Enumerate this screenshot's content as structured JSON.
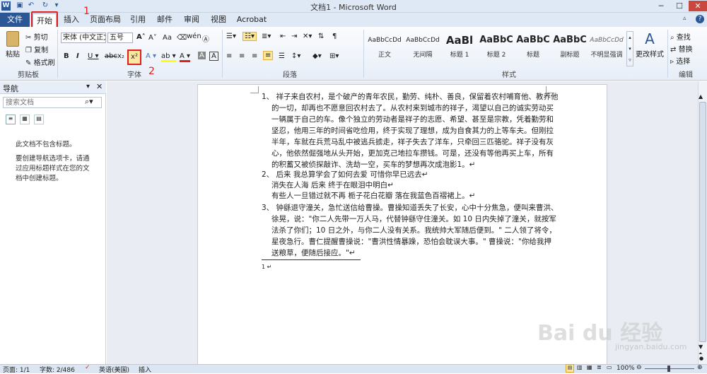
{
  "window": {
    "title": "文档1 - Microsoft Word"
  },
  "tabs": [
    "文件",
    "开始",
    "插入",
    "页面布局",
    "引用",
    "邮件",
    "审阅",
    "视图",
    "Acrobat"
  ],
  "annotations": {
    "mark1": "1",
    "mark2": "2"
  },
  "clipboard": {
    "paste": "粘贴",
    "cut": "剪切",
    "copy": "复制",
    "format_painter": "格式刷",
    "group": "剪贴板"
  },
  "font": {
    "name": "宋体 (中文正文)",
    "size": "五号",
    "group": "字体"
  },
  "paragraph": {
    "group": "段落"
  },
  "styles": {
    "group": "样式",
    "items": [
      {
        "preview": "AaBbCcDd",
        "label": "正文"
      },
      {
        "preview": "AaBbCcDd",
        "label": "无间隔"
      },
      {
        "preview": "AaBl",
        "label": "标题 1"
      },
      {
        "preview": "AaBbC",
        "label": "标题 2"
      },
      {
        "preview": "AaBbC",
        "label": "标题"
      },
      {
        "preview": "AaBbC",
        "label": "副标题"
      },
      {
        "preview": "AaBbCcDd",
        "label": "不明显强调"
      }
    ],
    "change": "更改样式"
  },
  "editing": {
    "find": "查找",
    "replace": "替换",
    "select": "选择",
    "group": "编辑"
  },
  "nav": {
    "title": "导航",
    "search_placeholder": "搜索文档",
    "msg1": "此文档不包含标题。",
    "msg2": "要创建导航选项卡，请通过应用标题样式在您的文档中创建标题。"
  },
  "doc": {
    "lines": [
      "1、 祥子来自农村，是个破产的青年农民，勤劳、纯朴、善良，保留着农村哺育他、教养他",
      "的一切，却再也不愿意回农村去了。从农村来到城市的祥子，渴望以自己的诚实劳动买",
      "一辆属于自己的车。像个独立的劳动者是祥子的志愿、希望、甚至是宗教，凭着勤劳和",
      "坚忍，他用三年的时间省吃俭用，终于实现了理想，成为自食其力的上等车夫。但刚拉",
      "半年，车就在兵荒马乱中被逃兵掳走，祥子失去了洋车，只牵回三匹骆驼。祥子没有灰",
      "心，他依然倔强地从头开始，更加克己地拉车攒钱。可是，还没有等他再买上车，所有",
      "的积蓄又被侦探敲诈、洗劫一空，买车的梦想再次成泡影1。↵",
      "2、 后来    我总算学会了如何去爱      可惜你早已远去↵",
      "消失在人海      后来      终于在眼泪中明白↵",
      "有些人一旦错过就不再      栀子花白花瓣      落在我蓝色百褶裙上。↵",
      "3、 钟繇退守潼关，急忙送信给曹操。曹操知道丢失了长安，心中十分焦急，便叫来曹洪、",
      "徐晃，说：\"你二人先带一万人马，代替钟繇守住潼关。如 10 日内失掉了潼关，就按军",
      "法杀了你们；10 日之外，与你二人没有关系。我统帅大军随后便到。\" 二人领了将令，",
      "星夜急行。曹仁提醒曹操说：\"曹洪性情暴躁，恐怕会耽误大事。\" 曹操说：\"你给我押",
      "送粮草，便随后接应。\"↵"
    ],
    "footnote": "1 ↵"
  },
  "status": {
    "page": "页面: 1/1",
    "words": "字数: 2/486",
    "lang": "英语(美国)",
    "mode": "插入",
    "zoom": "100%"
  },
  "watermark": {
    "brand": "Bai du 经验",
    "url": "jingyan.baidu.com"
  }
}
